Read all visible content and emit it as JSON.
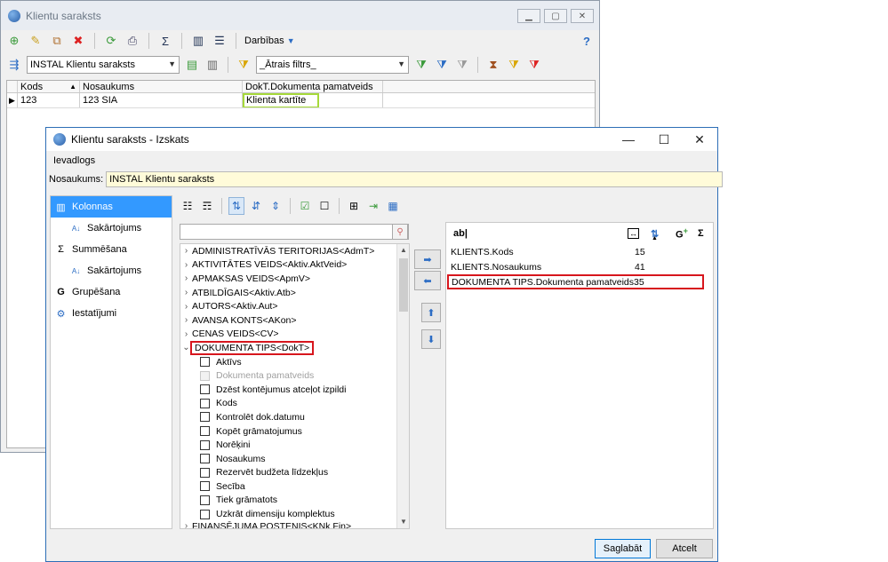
{
  "back_window": {
    "title": "Klientu saraksts",
    "actions_label": "Darbības",
    "layout_select": "INSTAL Klientu saraksts",
    "filter_select": "_Ātrais filtrs_",
    "grid": {
      "columns": [
        "Kods",
        "Nosaukums",
        "DokT.Dokumenta pamatveids"
      ],
      "rows": [
        [
          "123",
          "123 SIA",
          "Klienta kartīte"
        ]
      ]
    }
  },
  "dialog": {
    "title": "Klientu saraksts - Izskats",
    "menu": "Ievadlogs",
    "name_label": "Nosaukums:",
    "name_value": "INSTAL Klientu saraksts",
    "nav": [
      "Kolonnas",
      "Sakārtojums",
      "Summēšana",
      "Sakārtojums",
      "Grupēšana",
      "Iestatījumi"
    ],
    "tree": {
      "groups": [
        "ADMINISTRATĪVĀS TERITORIJAS<AdmT>",
        "AKTIVITĀTES VEIDS<Aktiv.AktVeid>",
        "APMAKSAS VEIDS<ApmV>",
        "ATBILDĪGAIS<Aktiv.Atb>",
        "AUTORS<Aktiv.Aut>",
        "AVANSA KONTS<AKon>",
        "CENAS VEIDS<CV>"
      ],
      "expanded_group": "DOKUMENTA TIPS<DokT>",
      "children": [
        "Aktīvs",
        "Dokumenta pamatveids",
        "Dzēst kontējumus atceļot izpildi",
        "Kods",
        "Kontrolēt dok.datumu",
        "Kopēt grāmatojumus",
        "Norēķini",
        "Nosaukums",
        "Rezervēt budžeta līdzekļus",
        "Secība",
        "Tiek grāmatots",
        "Uzkrāt dimensiju komplektus"
      ],
      "cut_off": "FINANSĒJUMA POSTENIS<KNk.Fin>"
    },
    "selected": {
      "header_label": "ab|",
      "rows": [
        {
          "name": "KLIENTS.Kods",
          "width": "15"
        },
        {
          "name": "KLIENTS.Nosaukums",
          "width": "41"
        },
        {
          "name": "DOKUMENTA TIPS.Dokumenta pamatveids",
          "width": "35"
        }
      ]
    },
    "save_label": "Saglabāt",
    "cancel_label": "Atcelt"
  },
  "colors": {
    "highlight_red": "#d7161d",
    "highlight_green": "#a6d93a",
    "nav_active": "#3399ff"
  }
}
